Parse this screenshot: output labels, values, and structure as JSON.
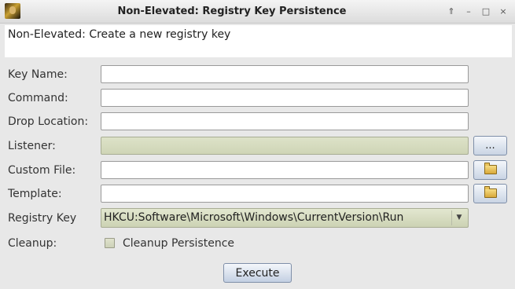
{
  "window": {
    "title": "Non-Elevated: Registry Key Persistence",
    "controls": {
      "shade": "⇑",
      "minimize": "–",
      "maximize": "□",
      "close": "×"
    }
  },
  "description": "Non-Elevated: Create a new registry key",
  "form": {
    "key_name": {
      "label": "Key Name:",
      "value": ""
    },
    "command": {
      "label": "Command:",
      "value": ""
    },
    "drop_location": {
      "label": "Drop Location:",
      "value": ""
    },
    "listener": {
      "label": "Listener:",
      "value": "",
      "button_label": "..."
    },
    "custom_file": {
      "label": "Custom File:",
      "value": "",
      "button_icon": "folder-icon"
    },
    "template": {
      "label": "Template:",
      "value": "",
      "button_icon": "folder-icon"
    },
    "registry_key": {
      "label": "Registry Key",
      "selected": "HKCU:Software\\Microsoft\\Windows\\CurrentVersion\\Run"
    },
    "cleanup": {
      "label": "Cleanup:",
      "checkbox_label": "Cleanup Persistence",
      "checked": false
    }
  },
  "execute_label": "Execute"
}
